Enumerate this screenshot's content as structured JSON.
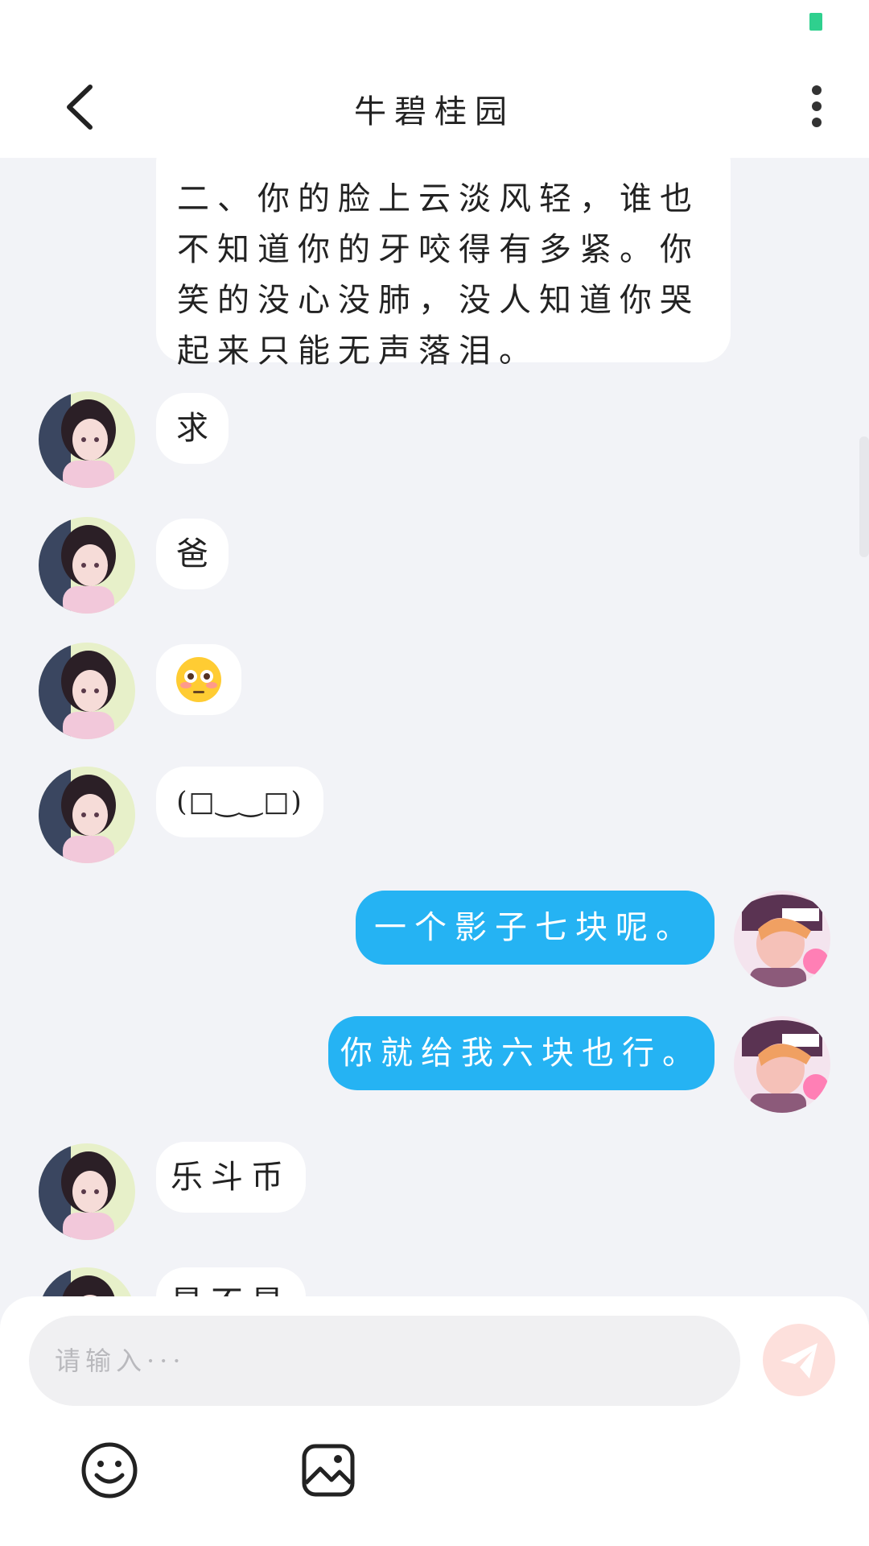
{
  "header": {
    "title": "牛碧桂园"
  },
  "messages": {
    "m0": "二、你的脸上云淡风轻，谁也不知道你的牙咬得有多紧。你笑的没心没肺，没人知道你哭起来只能无声落泪。",
    "m1": "求",
    "m2": "爸",
    "m3": "😳",
    "m4": "(​□‿‿□​)",
    "m5": "一个影子七块呢。",
    "m6": "你就给我六块也行。",
    "m7": "乐斗币",
    "m8": "是不是"
  },
  "input": {
    "placeholder": "请输入···"
  },
  "icons": {
    "back": "chevron-left-icon",
    "more": "more-vertical-icon",
    "send": "send-icon",
    "emoji": "emoji-icon",
    "image": "image-icon"
  },
  "colors": {
    "outgoing_bubble": "#25b3f3",
    "incoming_bubble": "#ffffff",
    "background": "#f2f3f7",
    "send_button": "#fde0dc"
  }
}
